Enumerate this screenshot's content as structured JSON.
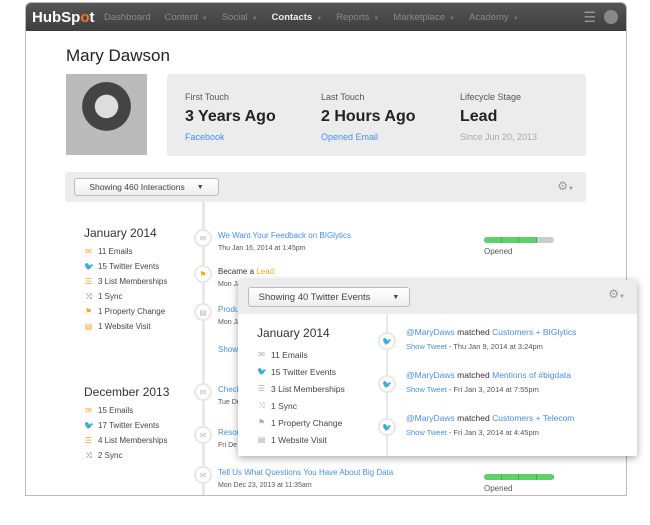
{
  "nav": {
    "logo": "HubSpot",
    "items": [
      {
        "label": "Dashboard",
        "caret": false
      },
      {
        "label": "Content",
        "caret": true
      },
      {
        "label": "Social",
        "caret": true
      },
      {
        "label": "Contacts",
        "caret": true,
        "active": true
      },
      {
        "label": "Reports",
        "caret": true
      },
      {
        "label": "Marketplace",
        "caret": true
      },
      {
        "label": "Academy",
        "caret": true
      }
    ]
  },
  "contact": {
    "name": "Mary Dawson"
  },
  "stats": [
    {
      "label": "First Touch",
      "value": "3 Years Ago",
      "sub": "Facebook"
    },
    {
      "label": "Last Touch",
      "value": "2 Hours Ago",
      "sub": "Opened Email"
    },
    {
      "label": "Lifecycle Stage",
      "value": "Lead",
      "sub": "Since Jun 20, 2013"
    }
  ],
  "filter": {
    "label": "Showing 460 Interactions"
  },
  "months": [
    {
      "title": "January 2014",
      "summary": [
        "11 Emails",
        "15 Twitter Events",
        "3 List Memberships",
        "1 Sync",
        "1 Property Change",
        "1 Website Visit"
      ]
    },
    {
      "title": "December 2013",
      "summary": [
        "15 Emails",
        "17 Twitter Events",
        "4 List Memberships",
        "2 Sync"
      ]
    }
  ],
  "events": [
    {
      "title": "We Want Your Feedback on BIGlytics",
      "date": "Thu Jan 16, 2014 at 1:45pm",
      "status": "Opened",
      "progress": 0.75
    },
    {
      "prefix": "Became a ",
      "link": "Lead",
      "date": "Mon Ja"
    },
    {
      "title": "Produ",
      "date": "Mon Ja"
    },
    {
      "title": "Show"
    },
    {
      "title": "Check",
      "date": "Tue De"
    },
    {
      "title": "Resou",
      "date": "Fri De"
    },
    {
      "title": "Tell Us What Questions You Have About Big Data",
      "date": "Mon Dec 23, 2013 at 11:35am",
      "status": "Opened",
      "progress": 1.0
    }
  ],
  "overlay": {
    "filter": "Showing 40 Twitter Events",
    "month": "January 2014",
    "summary": [
      "11 Emails",
      "15 Twitter Events",
      "3 List Memberships",
      "1 Sync",
      "1 Property Change",
      "1 Website Visit"
    ],
    "tweets": [
      {
        "handle": "@MaryDaws",
        "matched": " matched ",
        "list": "Customers + BIGlytics",
        "show": "Show Tweet",
        "date": " - Thu Jan 9, 2014 at 3:24pm"
      },
      {
        "handle": "@MaryDaws",
        "matched": " matched ",
        "list": "Mentions of #bigdata",
        "show": "Show Tweet",
        "date": " - Fri Jan 3, 2014 at 7:55pm"
      },
      {
        "handle": "@MaryDaws",
        "matched": " matched ",
        "list": "Customers + Telecom",
        "show": "Show Tweet",
        "date": " - Fri Jan 3, 2014 at 4:45pm"
      }
    ]
  },
  "colors": {
    "link": "#4a8ee8",
    "accent": "#f5a623",
    "progress": "#5fd16a",
    "twitter": "#3b87d8"
  }
}
